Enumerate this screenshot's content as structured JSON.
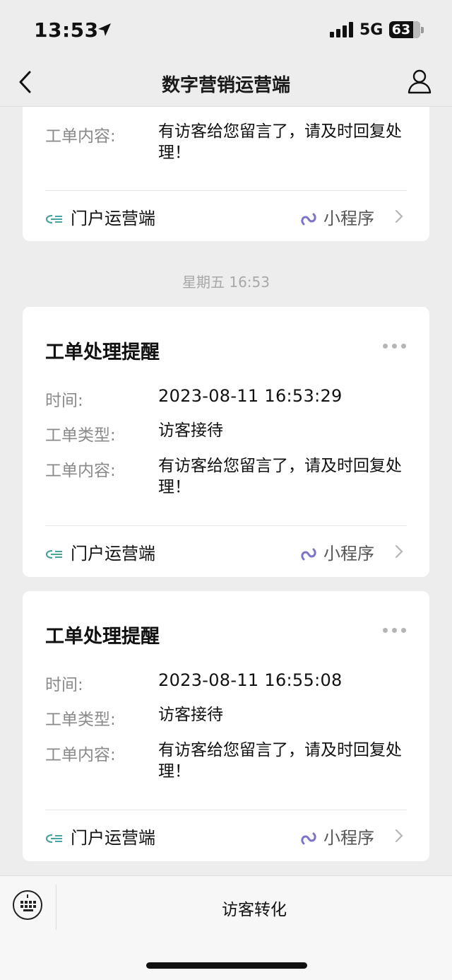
{
  "status_bar": {
    "time": "13:53",
    "network": "5G",
    "battery": "63"
  },
  "nav": {
    "title": "数字营销运营端"
  },
  "labels": {
    "time": "时间:",
    "type": "工单类型:",
    "content": "工单内容:"
  },
  "footer": {
    "source": "门户运营端",
    "mini_program": "小程序"
  },
  "partial_card": {
    "content": "有访客给您留言了，请及时回复处理！"
  },
  "date_separator": "星期五 16:53",
  "cards": [
    {
      "title": "工单处理提醒",
      "time": "2023-08-11 16:53:29",
      "type": "访客接待",
      "content": "有访客给您留言了，请及时回复处理！"
    },
    {
      "title": "工单处理提醒",
      "time": "2023-08-11 16:55:08",
      "type": "访客接待",
      "content": "有访客给您留言了，请及时回复处理！"
    }
  ],
  "bottom_menu": {
    "label": "访客转化"
  },
  "colors": {
    "accent_purple": "#7b74c9",
    "source_icon_teal": "#4aa3a0",
    "background": "#ededed"
  }
}
